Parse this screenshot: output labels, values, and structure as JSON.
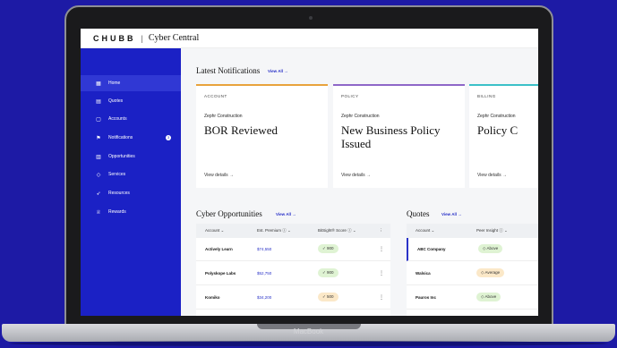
{
  "header": {
    "logo": "CHUBB",
    "separator": "|",
    "app_name": "Cyber Central"
  },
  "sidebar": {
    "items": [
      {
        "label": "Home",
        "icon": "grid-icon"
      },
      {
        "label": "Quotes",
        "icon": "quote-icon"
      },
      {
        "label": "Accounts",
        "icon": "document-icon"
      },
      {
        "label": "Notifications",
        "icon": "flag-icon",
        "badge": "3"
      },
      {
        "label": "Opportunities",
        "icon": "chart-icon"
      },
      {
        "label": "Services",
        "icon": "shield-icon"
      },
      {
        "label": "Resources",
        "icon": "rocket-icon"
      },
      {
        "label": "Rewards",
        "icon": "trophy-icon"
      }
    ]
  },
  "notifications": {
    "title": "Latest Notifications",
    "view_all": "View All →",
    "cards": [
      {
        "category": "ACCOUNT",
        "company": "Zephr Construction",
        "headline": "BOR Reviewed",
        "details": "View details →"
      },
      {
        "category": "POLICY",
        "company": "Zephr Construction",
        "headline": "New Business Policy Issued",
        "details": "View details →"
      },
      {
        "category": "BILLING",
        "company": "Zephr Construction",
        "headline": "Policy C",
        "details": "View details →"
      }
    ]
  },
  "opportunities": {
    "title": "Cyber Opportunities",
    "view_all": "View All →",
    "columns": [
      "Account ⌄",
      "Est. Premium ⓘ ⌄",
      "BitSight® Score ⓘ ⌄"
    ],
    "rows": [
      {
        "account": "Actively Learn",
        "premium": "$74,550",
        "score": "900"
      },
      {
        "account": "Polyskope Labs",
        "premium": "$52,750",
        "score": "900"
      },
      {
        "account": "Komiko",
        "premium": "$34,200",
        "score": "500"
      }
    ]
  },
  "quotes": {
    "title": "Quotes",
    "view_all": "View All →",
    "columns": [
      "Account ⌄",
      "Peer Insight ⓘ ⌄"
    ],
    "rows": [
      {
        "account": "ABC Company",
        "insight": "Above"
      },
      {
        "account": "Walsica",
        "insight": "Average"
      },
      {
        "account": "Pauros Inc",
        "insight": "Above"
      }
    ]
  },
  "device": {
    "label": "MacBook"
  }
}
